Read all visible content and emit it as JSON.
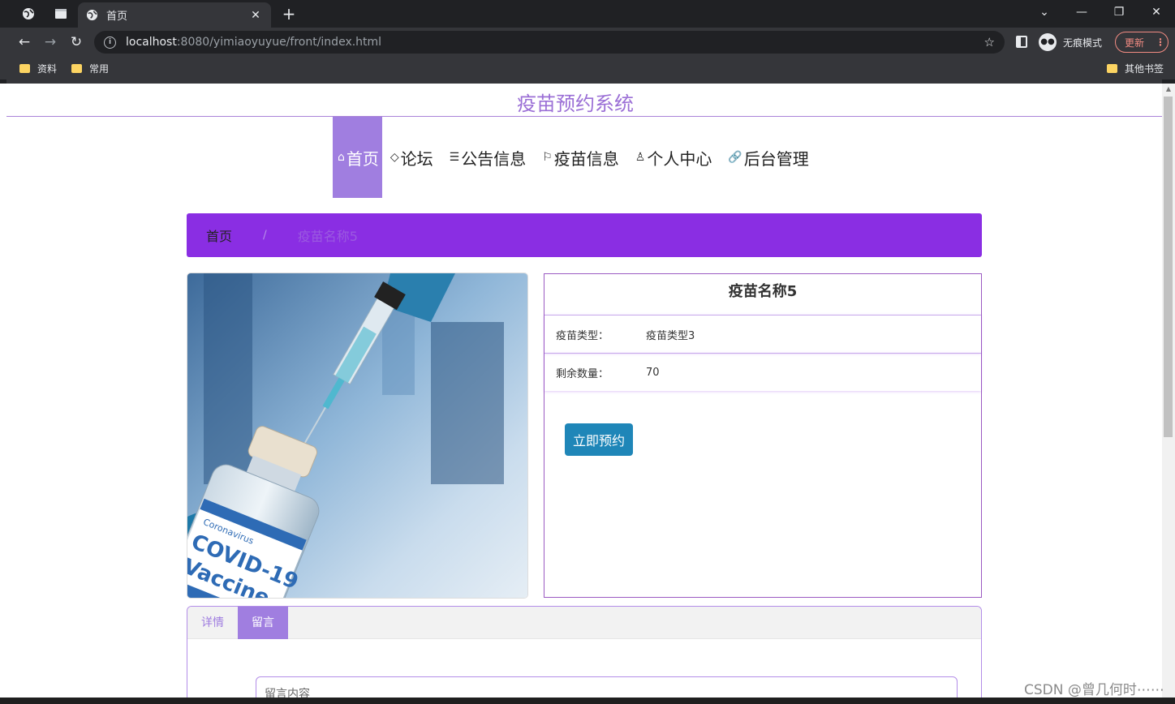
{
  "browser": {
    "active_tab_title": "首页",
    "url_host": "localhost",
    "url_rest": ":8080/yimiaoyuyue/front/index.html",
    "incognito_label": "无痕模式",
    "update_label": "更新",
    "bookmarks": [
      {
        "label": "资料"
      },
      {
        "label": "常用"
      }
    ],
    "other_bookmarks": "其他书签"
  },
  "site": {
    "title": "疫苗预约系统"
  },
  "nav": [
    {
      "icon": "⌂",
      "label": "首页"
    },
    {
      "icon": "◇",
      "label": "论坛"
    },
    {
      "icon": "☰",
      "label": "公告信息"
    },
    {
      "icon": "⚐",
      "label": "疫苗信息"
    },
    {
      "icon": "♙",
      "label": "个人中心"
    },
    {
      "icon": "🔗",
      "label": "后台管理"
    }
  ],
  "breadcrumb": {
    "home": "首页",
    "separator": "/",
    "current": "疫苗名称5"
  },
  "product": {
    "name": "疫苗名称5",
    "type_label": "疫苗类型：",
    "type_value": "疫苗类型3",
    "stock_label": "剩余数量：",
    "stock_value": "70",
    "reserve_button": "立即预约",
    "image_text": {
      "brand": "Coronavirus",
      "name1": "COVID-19",
      "name2": "Vaccine"
    }
  },
  "tabs": [
    {
      "label": "详情"
    },
    {
      "label": "留言"
    }
  ],
  "comment": {
    "placeholder": "留言内容"
  },
  "watermark": "CSDN @曾几何时⋯⋯",
  "colors": {
    "accent_purple": "#8a2ee3",
    "nav_active": "#a07ee0",
    "button_blue": "#1f86b8",
    "title_purple": "#9b6fd6"
  }
}
